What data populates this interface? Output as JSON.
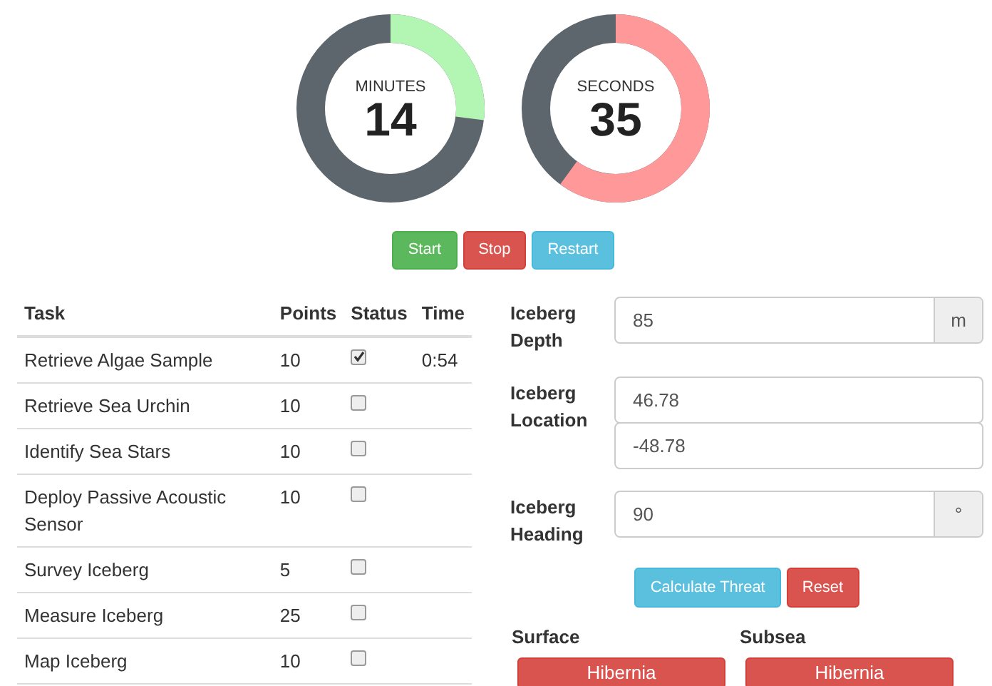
{
  "gauges": [
    {
      "label": "MINUTES",
      "value": "14",
      "level": 0.27,
      "color": "#b3f5b3"
    },
    {
      "label": "SECONDS",
      "value": "35",
      "level": 0.6,
      "color": "#ff9999"
    }
  ],
  "timer_buttons": [
    {
      "label": "Start",
      "kind": "success"
    },
    {
      "label": "Stop",
      "kind": "danger"
    },
    {
      "label": "Restart",
      "kind": "info"
    }
  ],
  "table": {
    "columns": [
      "Task",
      "Points",
      "Status",
      "Time"
    ],
    "rows": [
      {
        "task": "Retrieve Algae Sample",
        "points": "10",
        "checked": true,
        "time": "0:54"
      },
      {
        "task": "Retrieve Sea Urchin",
        "points": "10",
        "checked": false
      },
      {
        "task": "Identify Sea Stars",
        "points": "10",
        "checked": false
      },
      {
        "task": "Deploy Passive Acoustic Sensor",
        "points": "10",
        "checked": false
      },
      {
        "task": "Survey Iceberg",
        "points": "5",
        "checked": false
      },
      {
        "task": "Measure Iceberg",
        "points": "25",
        "checked": false
      },
      {
        "task": "Map Iceberg",
        "points": "10",
        "checked": false
      }
    ]
  },
  "form": {
    "fields": [
      {
        "label": "Iceberg Depth",
        "values": [
          "85"
        ],
        "addon": "m"
      },
      {
        "label": "Iceberg Location",
        "values": [
          "46.78",
          "-48.78"
        ]
      },
      {
        "label": "Iceberg Heading",
        "values": [
          "90"
        ],
        "addon": "°"
      }
    ],
    "buttons": [
      {
        "label": "Calculate Threat",
        "kind": "info"
      },
      {
        "label": "Reset",
        "kind": "danger"
      }
    ]
  },
  "results": [
    {
      "heading": "Surface",
      "button": "Hibernia"
    },
    {
      "heading": "Subsea",
      "button": "Hibernia"
    }
  ]
}
